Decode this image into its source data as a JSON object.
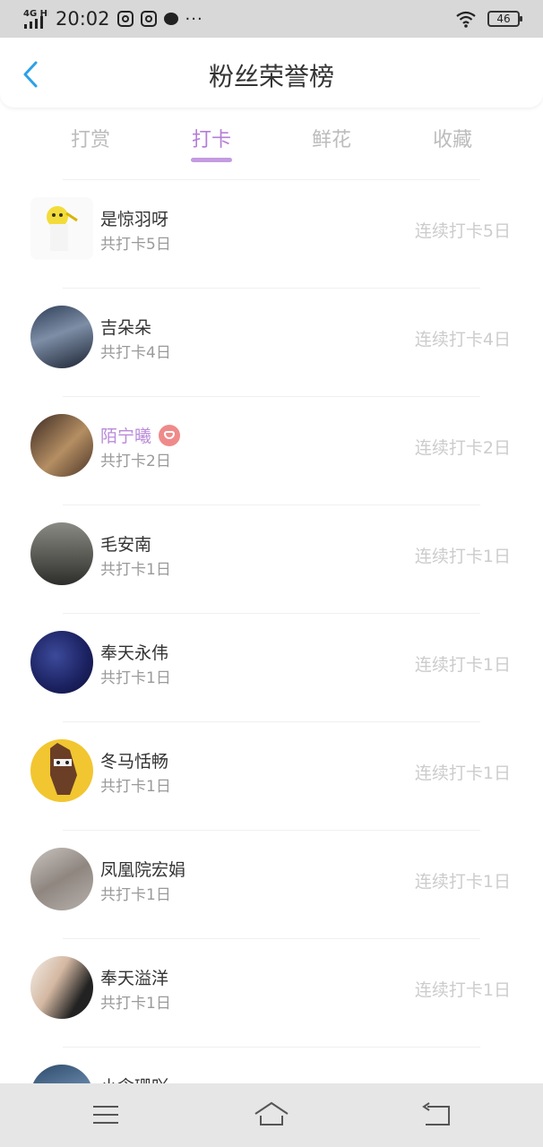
{
  "status_bar": {
    "signal": "4G HD",
    "time": "20:02",
    "battery": "46"
  },
  "header": {
    "title": "粉丝荣誉榜"
  },
  "tabs": [
    {
      "label": "打赏",
      "active": false
    },
    {
      "label": "打卡",
      "active": true
    },
    {
      "label": "鲜花",
      "active": false
    },
    {
      "label": "收藏",
      "active": false
    }
  ],
  "fans": [
    {
      "name": "是惊羽呀",
      "total": "共打卡5日",
      "streak": "连续打卡5日"
    },
    {
      "name": "吉朵朵",
      "total": "共打卡4日",
      "streak": "连续打卡4日"
    },
    {
      "name": "陌宁曦",
      "total": "共打卡2日",
      "streak": "连续打卡2日"
    },
    {
      "name": "毛安南",
      "total": "共打卡1日",
      "streak": "连续打卡1日"
    },
    {
      "name": "奉天永伟",
      "total": "共打卡1日",
      "streak": "连续打卡1日"
    },
    {
      "name": "冬马恬畅",
      "total": "共打卡1日",
      "streak": "连续打卡1日"
    },
    {
      "name": "凤凰院宏娟",
      "total": "共打卡1日",
      "streak": "连续打卡1日"
    },
    {
      "name": "奉天溢洋",
      "total": "共打卡1日",
      "streak": "连续打卡1日"
    },
    {
      "name": "小念珊吖",
      "total": "",
      "streak": ""
    }
  ],
  "colors": {
    "accent": "#b57fd6",
    "tab_inactive": "#bcbcbc",
    "streak_text": "#cccccc",
    "vip_badge": "#f08a8a"
  }
}
